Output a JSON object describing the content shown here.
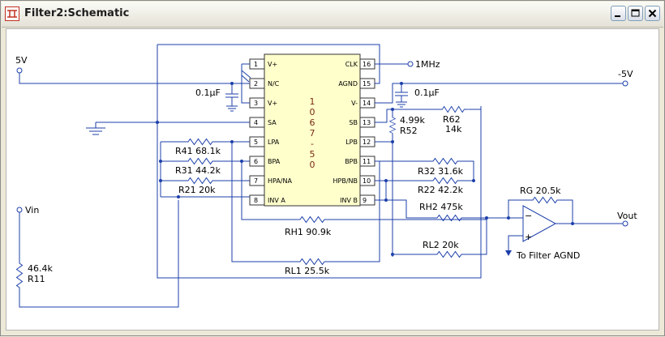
{
  "window": {
    "title": "Filter2:Schematic"
  },
  "ic": {
    "part_chars": [
      "1",
      "0",
      "6",
      "7",
      "-",
      "5",
      "0"
    ],
    "left_pins": [
      {
        "num": "1",
        "label": "V+"
      },
      {
        "num": "2",
        "label": "N/C"
      },
      {
        "num": "3",
        "label": "V+"
      },
      {
        "num": "4",
        "label": "SA"
      },
      {
        "num": "5",
        "label": "LPA"
      },
      {
        "num": "6",
        "label": "BPA"
      },
      {
        "num": "7",
        "label": "HPA/NA"
      },
      {
        "num": "8",
        "label": "INV A"
      }
    ],
    "right_pins": [
      {
        "num": "16",
        "label": "CLK"
      },
      {
        "num": "15",
        "label": "AGND"
      },
      {
        "num": "14",
        "label": "V-"
      },
      {
        "num": "13",
        "label": "SB"
      },
      {
        "num": "12",
        "label": "LPB"
      },
      {
        "num": "11",
        "label": "BPB"
      },
      {
        "num": "10",
        "label": "HPB/NB"
      },
      {
        "num": "9",
        "label": "INV B"
      }
    ]
  },
  "labels": {
    "vplus": "5V",
    "vminus": "-5V",
    "clk": "1MHz",
    "cap1": "0.1µF",
    "cap2": "0.1µF",
    "vin": "Vin",
    "vout": "Vout",
    "to_agnd": "To Filter AGND",
    "r41": "R41 68.1k",
    "r31": "R31 44.2k",
    "r21": "R21 20k",
    "rh1": "RH1 90.9k",
    "rl1": "RL1 25.5k",
    "r52_val": "4.99k",
    "r52_name": "R52",
    "r62_name": "R62",
    "r62_val": "14k",
    "r32": "R32 31.6k",
    "r22": "R22 42.2k",
    "rh2": "RH2 475k",
    "rl2": "RL2 20k",
    "rg": "RG 20.5k",
    "r11_val": "46.4k",
    "r11_name": "R11"
  }
}
